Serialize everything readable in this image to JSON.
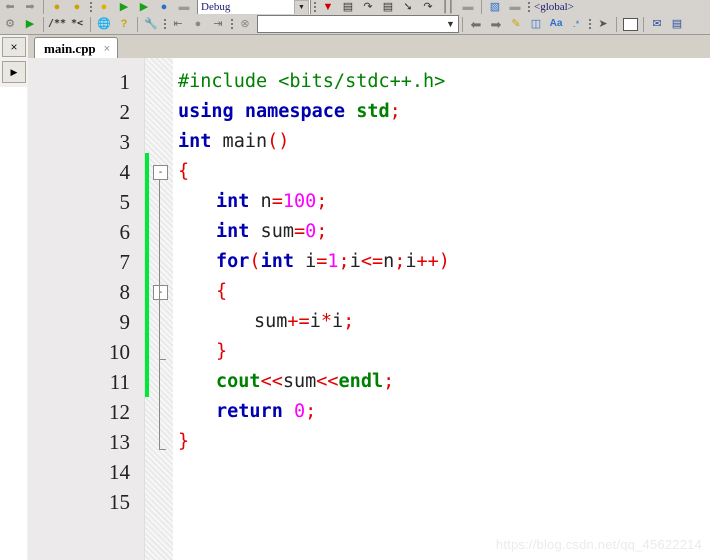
{
  "window": {
    "app": "Dev-C++ IDE"
  },
  "toolbar_top": {
    "config_selector": "Debug",
    "scope_selector": "<global>",
    "icons": [
      "undo-icon",
      "redo-icon",
      "compile-icon",
      "run-icon",
      "compile-run-icon",
      "rebuild-icon",
      "stop-icon",
      "debug-icon",
      "step-over-icon",
      "step-into-icon",
      "next-line-icon",
      "pause-icon",
      "profile-icon",
      "window-icon"
    ]
  },
  "toolbar_main": {
    "icons": [
      "print-icon",
      "run-icon",
      "comment-icon",
      "uncomment-icon",
      "browser-icon",
      "help-icon",
      "settings-icon",
      "prev-icon",
      "stop-icon",
      "next-icon",
      "abort-icon"
    ],
    "class_combo_value": "",
    "class_combo_placeholder": "",
    "nav_back": "back-arrow-icon",
    "nav_forward": "forward-arrow-icon",
    "pencil": "pencil-icon",
    "swap": "swap-icon",
    "font": "font-icon",
    "bookmark": "bookmark-icon",
    "pointer": "pointer-icon",
    "rect": "rectangle-icon",
    "mail": "mail-icon",
    "page": "page-icon"
  },
  "left_dock": {
    "close_label": "×",
    "expand_label": "▶"
  },
  "tab": {
    "label": "main.cpp",
    "close": "×"
  },
  "editor": {
    "watermark": "https://blog.csdn.net/qq_45622214",
    "change_bar_color": "#00e838",
    "colors": {
      "keyword": "#0000b0",
      "preprocessor": "#008000",
      "identifier": "#222222",
      "number": "#ff00ff",
      "punctuation": "#e00000",
      "background": "#ffffff",
      "gutter": "#eceaea"
    },
    "line_numbers": [
      1,
      2,
      3,
      4,
      5,
      6,
      7,
      8,
      9,
      10,
      11,
      12,
      13,
      14,
      15
    ],
    "lines": [
      {
        "n": 1,
        "indent": 0,
        "text": "#include <bits/stdc++.h>",
        "tokens": [
          {
            "t": "#include <bits/stdc++.h>",
            "c": "g"
          }
        ]
      },
      {
        "n": 2,
        "indent": 0,
        "text": "using namespace std;",
        "tokens": [
          {
            "t": "using namespace ",
            "c": "k"
          },
          {
            "t": "std",
            "c": "gb"
          },
          {
            "t": ";",
            "c": "p"
          }
        ]
      },
      {
        "n": 3,
        "indent": 0,
        "text": "int main()",
        "tokens": [
          {
            "t": "int",
            "c": "k"
          },
          {
            "t": " main",
            "c": "n"
          },
          {
            "t": "()",
            "c": "p"
          }
        ]
      },
      {
        "n": 4,
        "indent": 0,
        "text": "{",
        "tokens": [
          {
            "t": "{",
            "c": "p"
          }
        ]
      },
      {
        "n": 5,
        "indent": 1,
        "text": "int n=100;",
        "tokens": [
          {
            "t": "int",
            "c": "k"
          },
          {
            "t": " n",
            "c": "n"
          },
          {
            "t": "=",
            "c": "p"
          },
          {
            "t": "100",
            "c": "num"
          },
          {
            "t": ";",
            "c": "p"
          }
        ]
      },
      {
        "n": 6,
        "indent": 1,
        "text": "int sum=0;",
        "tokens": [
          {
            "t": "int",
            "c": "k"
          },
          {
            "t": " sum",
            "c": "n"
          },
          {
            "t": "=",
            "c": "p"
          },
          {
            "t": "0",
            "c": "num"
          },
          {
            "t": ";",
            "c": "p"
          }
        ]
      },
      {
        "n": 7,
        "indent": 1,
        "text": "for(int i=1;i<=n;i++)",
        "tokens": [
          {
            "t": "for",
            "c": "k"
          },
          {
            "t": "(",
            "c": "p"
          },
          {
            "t": "int",
            "c": "k"
          },
          {
            "t": " i",
            "c": "n"
          },
          {
            "t": "=",
            "c": "p"
          },
          {
            "t": "1",
            "c": "num"
          },
          {
            "t": ";",
            "c": "p"
          },
          {
            "t": "i",
            "c": "n"
          },
          {
            "t": "<=",
            "c": "p"
          },
          {
            "t": "n",
            "c": "n"
          },
          {
            "t": ";",
            "c": "p"
          },
          {
            "t": "i",
            "c": "n"
          },
          {
            "t": "++)",
            "c": "p"
          }
        ]
      },
      {
        "n": 8,
        "indent": 1,
        "text": "{",
        "tokens": [
          {
            "t": "{",
            "c": "p"
          }
        ]
      },
      {
        "n": 9,
        "indent": 2,
        "text": "sum+=i*i;",
        "tokens": [
          {
            "t": "sum",
            "c": "n"
          },
          {
            "t": "+=",
            "c": "p"
          },
          {
            "t": "i",
            "c": "n"
          },
          {
            "t": "*",
            "c": "p"
          },
          {
            "t": "i",
            "c": "n"
          },
          {
            "t": ";",
            "c": "p"
          }
        ]
      },
      {
        "n": 10,
        "indent": 1,
        "text": "}",
        "tokens": [
          {
            "t": "}",
            "c": "p"
          }
        ]
      },
      {
        "n": 11,
        "indent": 1,
        "text": "cout<<sum<<endl;",
        "tokens": [
          {
            "t": "cout",
            "c": "gb"
          },
          {
            "t": "<<",
            "c": "p"
          },
          {
            "t": "sum",
            "c": "n"
          },
          {
            "t": "<<",
            "c": "p"
          },
          {
            "t": "endl",
            "c": "gb"
          },
          {
            "t": ";",
            "c": "p"
          }
        ]
      },
      {
        "n": 12,
        "indent": 1,
        "text": "return 0;",
        "tokens": [
          {
            "t": "return",
            "c": "k"
          },
          {
            "t": " ",
            "c": "n"
          },
          {
            "t": "0",
            "c": "num"
          },
          {
            "t": ";",
            "c": "p"
          }
        ]
      },
      {
        "n": 13,
        "indent": 0,
        "text": "}",
        "tokens": [
          {
            "t": "}",
            "c": "p"
          }
        ]
      },
      {
        "n": 14,
        "indent": 0,
        "text": "",
        "tokens": []
      },
      {
        "n": 15,
        "indent": 0,
        "text": "",
        "tokens": []
      }
    ],
    "fold_markers": [
      {
        "line": 4,
        "state": "-"
      },
      {
        "line": 8,
        "state": "-"
      }
    ]
  }
}
